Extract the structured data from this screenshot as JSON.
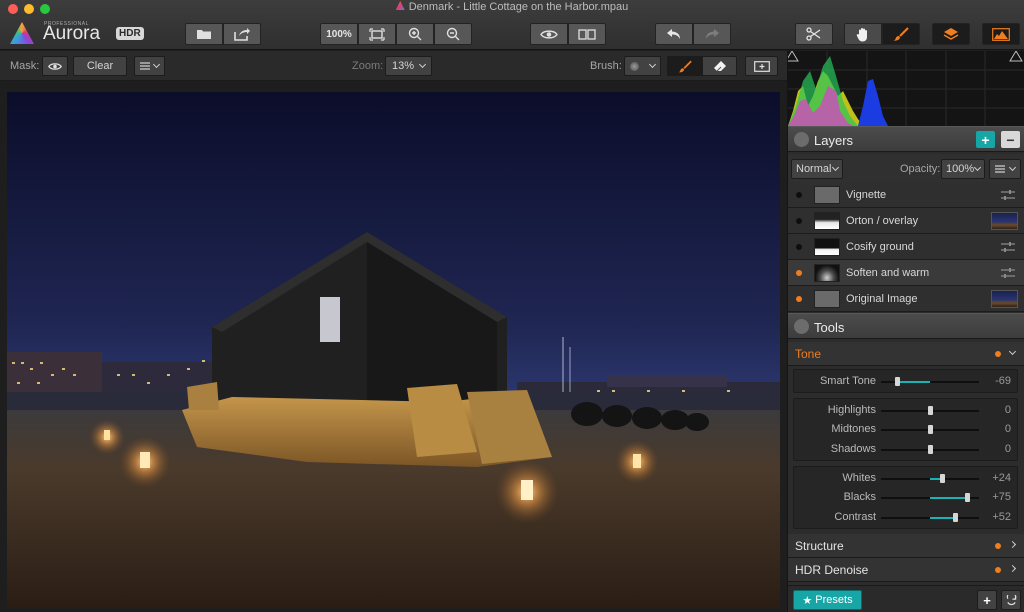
{
  "window": {
    "title": "Denmark - Little Cottage on the Harbor.mpau"
  },
  "logo": {
    "pro": "PROFESSIONAL",
    "name": "Aurora",
    "badge": "HDR"
  },
  "toolbar": {
    "zoom_fit_label": "100%"
  },
  "maskbar": {
    "mask_label": "Mask:",
    "clear_label": "Clear",
    "zoom_label": "Zoom:",
    "zoom_value": "13%",
    "brush_label": "Brush:"
  },
  "layers": {
    "title": "Layers",
    "add_label": "+",
    "remove_label": "−",
    "blend_mode": "Normal",
    "opacity_label": "Opacity:",
    "opacity_value": "100%",
    "items": [
      {
        "name": "Vignette",
        "visible": false,
        "thumb": "gray",
        "right": "slider"
      },
      {
        "name": "Orton / overlay",
        "visible": false,
        "thumb": "mask",
        "right": "photo"
      },
      {
        "name": "Cosify ground",
        "visible": false,
        "thumb": "mask-bottom",
        "right": "slider"
      },
      {
        "name": "Soften and warm",
        "visible": true,
        "thumb": "mask-dark",
        "right": "slider"
      },
      {
        "name": "Original Image",
        "visible": true,
        "thumb": "gray",
        "right": "photo"
      }
    ]
  },
  "tools": {
    "title": "Tools",
    "tone": {
      "title": "Tone",
      "sliders": [
        {
          "label": "Smart Tone",
          "value": "-69",
          "pos": 0.16,
          "fill_from": 0.16,
          "fill_to": 0.5
        },
        {
          "label": "Highlights",
          "value": "0",
          "pos": 0.5
        },
        {
          "label": "Midtones",
          "value": "0",
          "pos": 0.5
        },
        {
          "label": "Shadows",
          "value": "0",
          "pos": 0.5
        },
        {
          "label": "Whites",
          "value": "+24",
          "pos": 0.62,
          "fill_from": 0.5,
          "fill_to": 0.62
        },
        {
          "label": "Blacks",
          "value": "+75",
          "pos": 0.875,
          "fill_from": 0.5,
          "fill_to": 0.875
        },
        {
          "label": "Contrast",
          "value": "+52",
          "pos": 0.76,
          "fill_from": 0.5,
          "fill_to": 0.76
        }
      ]
    },
    "sections": [
      {
        "title": "Structure"
      },
      {
        "title": "HDR Denoise"
      }
    ]
  },
  "footer": {
    "presets_label": "Presets"
  },
  "colors": {
    "accent_orange": "#f07d1f",
    "accent_teal": "#1ab3b3"
  }
}
